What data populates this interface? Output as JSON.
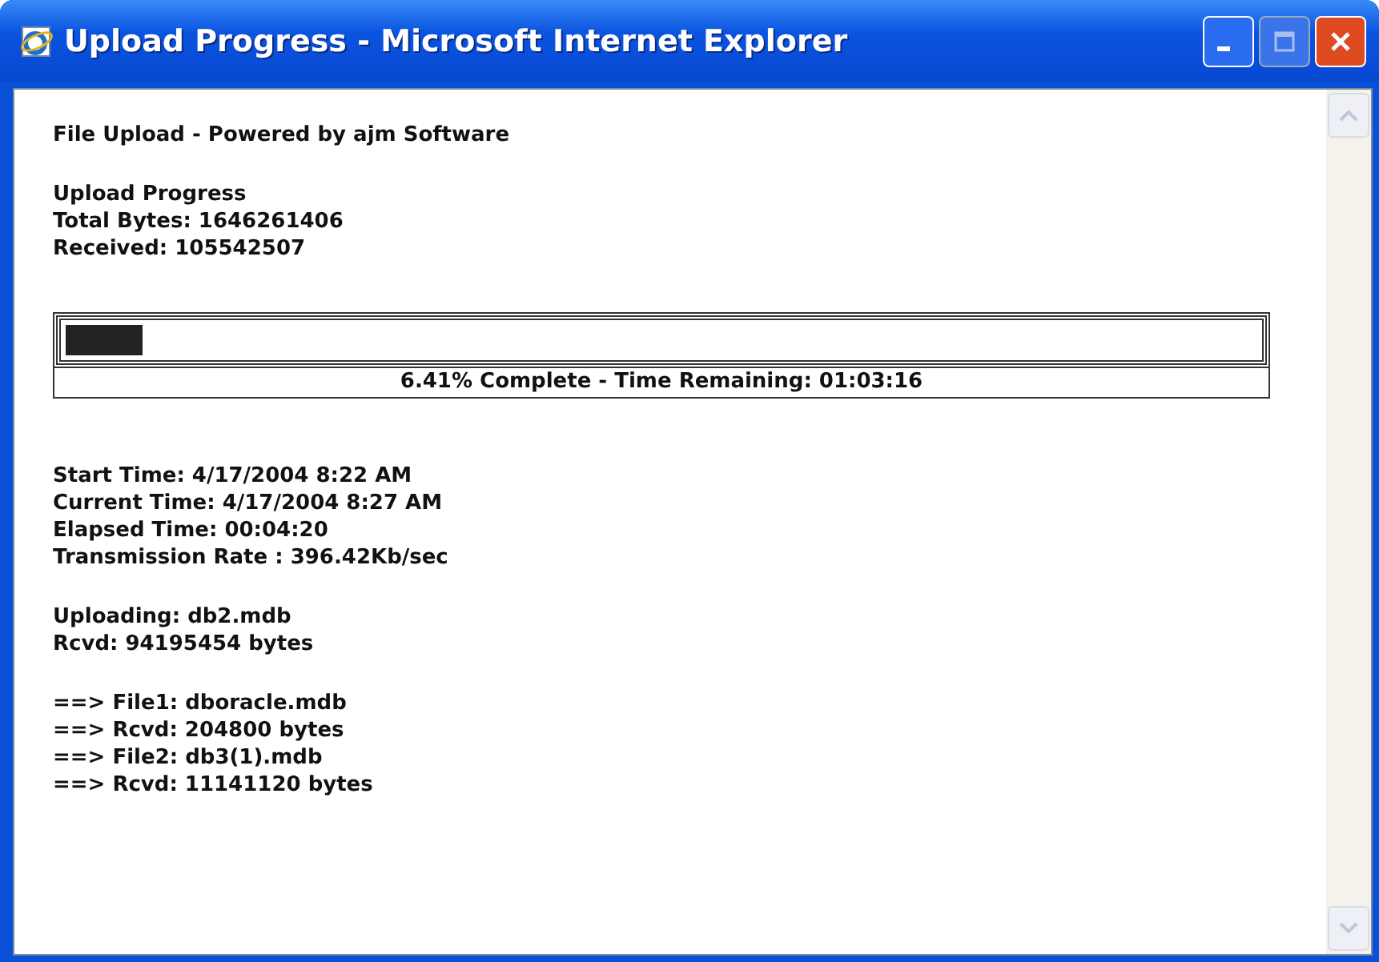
{
  "window": {
    "title": "Upload Progress - Microsoft Internet Explorer"
  },
  "heading": "File Upload - Powered by ajm Software",
  "summary": [
    "Upload Progress",
    "Total Bytes: 1646261406",
    "Received: 105542507"
  ],
  "progress": {
    "level": 0.0641,
    "caption": "6.41% Complete - Time Remaining: 01:03:16"
  },
  "timing": [
    "Start Time: 4/17/2004 8:22 AM",
    "Current Time: 4/17/2004 8:27 AM",
    "Elapsed Time: 00:04:20",
    "Transmission Rate : 396.42Kb/sec"
  ],
  "current": [
    "Uploading: db2.mdb",
    "Rcvd: 94195454 bytes"
  ],
  "files": [
    "==> File1: dboracle.mdb",
    "==> Rcvd: 204800 bytes",
    "==> File2: db3(1).mdb",
    "==> Rcvd: 11141120 bytes"
  ]
}
